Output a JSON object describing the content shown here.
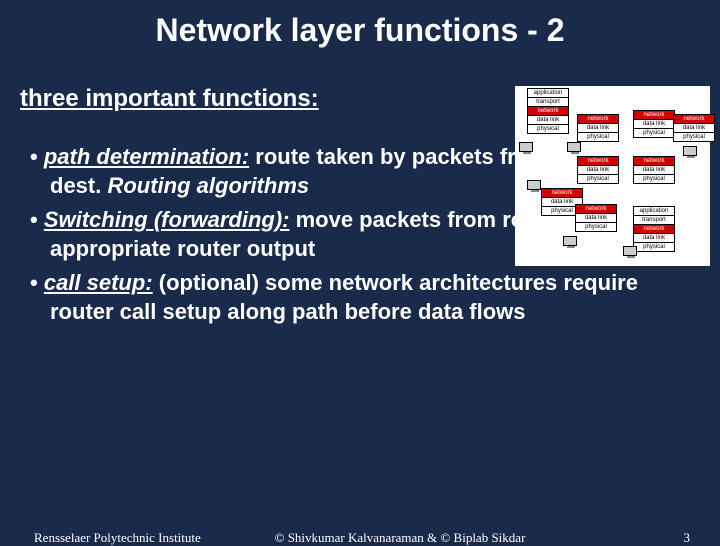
{
  "title": "Network layer functions - 2",
  "subtitle": "three important functions:",
  "bullets": [
    {
      "term": "path determination:",
      "rest1": " route taken by packets from source to dest. ",
      "ital": "Routing algorithms",
      "rest2": ""
    },
    {
      "term": "Switching (forwarding):",
      "rest1": " move packets from router's input to appropriate router output",
      "ital": "",
      "rest2": ""
    },
    {
      "term": "call setup:",
      "rest1": " (optional) some network architectures require router call setup along path before data flows",
      "ital": "",
      "rest2": ""
    }
  ],
  "stack5": [
    "application",
    "transport",
    "network",
    "data link",
    "physical"
  ],
  "stack3": [
    "network",
    "data link",
    "physical"
  ],
  "footer": {
    "institute": "Rensselaer Polytechnic Institute",
    "credits": "©  Shivkumar Kalvanaraman   &    ©  Biplab Sikdar",
    "page": "3"
  }
}
